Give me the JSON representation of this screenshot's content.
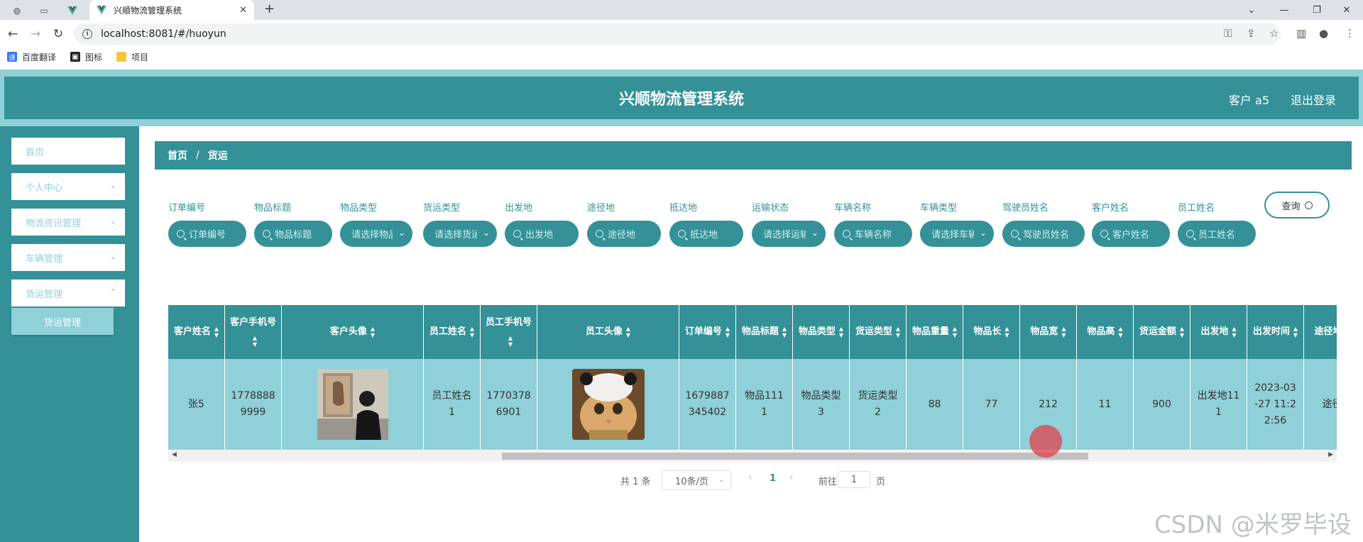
{
  "browser": {
    "tab_title": "兴顺物流管理系统",
    "url": "localhost:8081/#/huoyun",
    "bookmarks": [
      {
        "label": "百度翻译",
        "icon": "translate-icon",
        "color": "#3478f6"
      },
      {
        "label": "图标",
        "icon": "icon-bookmark-icon",
        "color": "#222222"
      },
      {
        "label": "项目",
        "icon": "folder-icon",
        "color": "#f4c542"
      }
    ]
  },
  "header": {
    "title": "兴顺物流管理系统",
    "user": "客户 a5",
    "logout": "退出登录"
  },
  "sidebar": {
    "items": [
      {
        "label": "首页"
      },
      {
        "label": "个人中心"
      },
      {
        "label": "物流资讯管理"
      },
      {
        "label": "车辆管理"
      },
      {
        "label": "货运管理"
      }
    ],
    "sub_item": "货运管理"
  },
  "breadcrumb": {
    "home": "首页",
    "sep": "/",
    "current": "货运"
  },
  "filters": [
    {
      "label": "订单编号",
      "placeholder": "订单编号",
      "type": "input"
    },
    {
      "label": "物品标题",
      "placeholder": "物品标题",
      "type": "input"
    },
    {
      "label": "物品类型",
      "placeholder": "请选择物品",
      "type": "select"
    },
    {
      "label": "货运类型",
      "placeholder": "请选择货运",
      "type": "select"
    },
    {
      "label": "出发地",
      "placeholder": "出发地",
      "type": "input"
    },
    {
      "label": "途径地",
      "placeholder": "途径地",
      "type": "input"
    },
    {
      "label": "抵达地",
      "placeholder": "抵达地",
      "type": "input"
    },
    {
      "label": "运输状态",
      "placeholder": "请选择运输",
      "type": "select"
    },
    {
      "label": "车辆名称",
      "placeholder": "车辆名称",
      "type": "input"
    },
    {
      "label": "车辆类型",
      "placeholder": "请选择车辆",
      "type": "select"
    },
    {
      "label": "驾驶员姓名",
      "placeholder": "驾驶员姓名",
      "type": "input"
    },
    {
      "label": "客户姓名",
      "placeholder": "客户姓名",
      "type": "input"
    },
    {
      "label": "员工姓名",
      "placeholder": "员工姓名",
      "type": "input"
    }
  ],
  "query_button": "查询",
  "table": {
    "columns": [
      "客户姓名",
      "客户手机号",
      "客户头像",
      "员工姓名",
      "员工手机号",
      "员工头像",
      "订单编号",
      "物品标题",
      "物品类型",
      "货运类型",
      "物品重量",
      "物品长",
      "物品宽",
      "物品高",
      "货运金额",
      "出发地",
      "出发时间",
      "途径地"
    ],
    "rows": [
      [
        "张5",
        "17788889999",
        "",
        "员工姓名1",
        "17703786901",
        "",
        "1679887345402",
        "物品1111",
        "物品类型3",
        "货运类型2",
        "88",
        "77",
        "212",
        "11",
        "900",
        "出发地111",
        "2023-03-27 11:22:56",
        "途径"
      ]
    ]
  },
  "pagination": {
    "total": "共 1 条",
    "page_size": "10条/页",
    "current_page": "1",
    "goto_label": "前往",
    "goto_value": "1",
    "page_suffix": "页"
  },
  "watermark": "CSDN @米罗毕设",
  "colors": {
    "primary": "#339197",
    "light": "#8fd0d9"
  }
}
